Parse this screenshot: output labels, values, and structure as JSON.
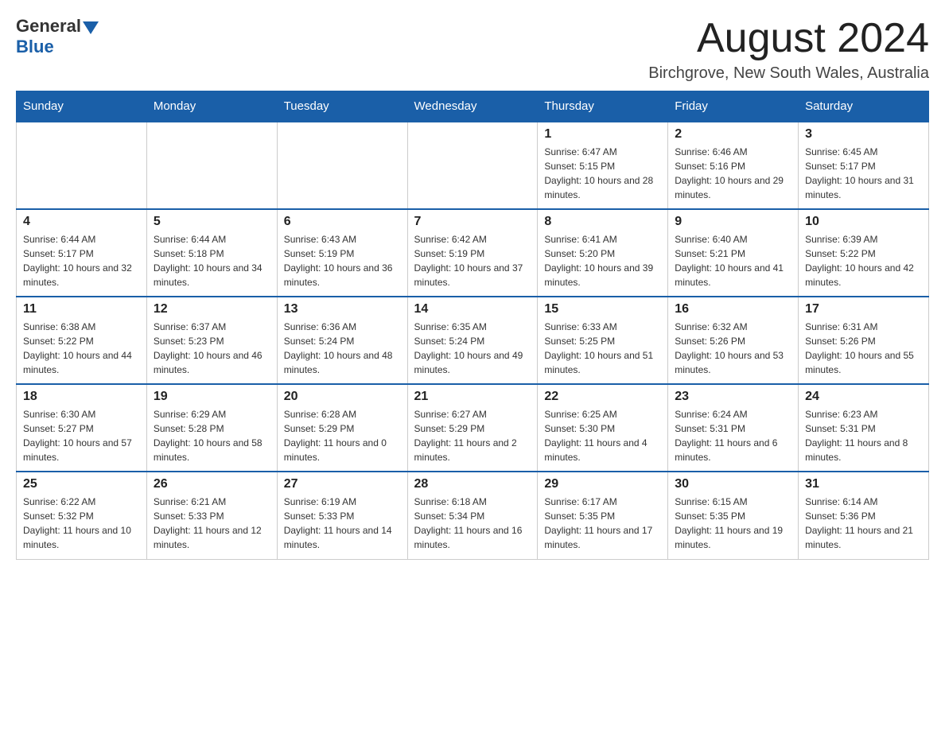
{
  "header": {
    "logo_general": "General",
    "logo_blue": "Blue",
    "month_title": "August 2024",
    "location": "Birchgrove, New South Wales, Australia"
  },
  "weekdays": [
    "Sunday",
    "Monday",
    "Tuesday",
    "Wednesday",
    "Thursday",
    "Friday",
    "Saturday"
  ],
  "weeks": [
    [
      {
        "day": "",
        "info": ""
      },
      {
        "day": "",
        "info": ""
      },
      {
        "day": "",
        "info": ""
      },
      {
        "day": "",
        "info": ""
      },
      {
        "day": "1",
        "info": "Sunrise: 6:47 AM\nSunset: 5:15 PM\nDaylight: 10 hours and 28 minutes."
      },
      {
        "day": "2",
        "info": "Sunrise: 6:46 AM\nSunset: 5:16 PM\nDaylight: 10 hours and 29 minutes."
      },
      {
        "day": "3",
        "info": "Sunrise: 6:45 AM\nSunset: 5:17 PM\nDaylight: 10 hours and 31 minutes."
      }
    ],
    [
      {
        "day": "4",
        "info": "Sunrise: 6:44 AM\nSunset: 5:17 PM\nDaylight: 10 hours and 32 minutes."
      },
      {
        "day": "5",
        "info": "Sunrise: 6:44 AM\nSunset: 5:18 PM\nDaylight: 10 hours and 34 minutes."
      },
      {
        "day": "6",
        "info": "Sunrise: 6:43 AM\nSunset: 5:19 PM\nDaylight: 10 hours and 36 minutes."
      },
      {
        "day": "7",
        "info": "Sunrise: 6:42 AM\nSunset: 5:19 PM\nDaylight: 10 hours and 37 minutes."
      },
      {
        "day": "8",
        "info": "Sunrise: 6:41 AM\nSunset: 5:20 PM\nDaylight: 10 hours and 39 minutes."
      },
      {
        "day": "9",
        "info": "Sunrise: 6:40 AM\nSunset: 5:21 PM\nDaylight: 10 hours and 41 minutes."
      },
      {
        "day": "10",
        "info": "Sunrise: 6:39 AM\nSunset: 5:22 PM\nDaylight: 10 hours and 42 minutes."
      }
    ],
    [
      {
        "day": "11",
        "info": "Sunrise: 6:38 AM\nSunset: 5:22 PM\nDaylight: 10 hours and 44 minutes."
      },
      {
        "day": "12",
        "info": "Sunrise: 6:37 AM\nSunset: 5:23 PM\nDaylight: 10 hours and 46 minutes."
      },
      {
        "day": "13",
        "info": "Sunrise: 6:36 AM\nSunset: 5:24 PM\nDaylight: 10 hours and 48 minutes."
      },
      {
        "day": "14",
        "info": "Sunrise: 6:35 AM\nSunset: 5:24 PM\nDaylight: 10 hours and 49 minutes."
      },
      {
        "day": "15",
        "info": "Sunrise: 6:33 AM\nSunset: 5:25 PM\nDaylight: 10 hours and 51 minutes."
      },
      {
        "day": "16",
        "info": "Sunrise: 6:32 AM\nSunset: 5:26 PM\nDaylight: 10 hours and 53 minutes."
      },
      {
        "day": "17",
        "info": "Sunrise: 6:31 AM\nSunset: 5:26 PM\nDaylight: 10 hours and 55 minutes."
      }
    ],
    [
      {
        "day": "18",
        "info": "Sunrise: 6:30 AM\nSunset: 5:27 PM\nDaylight: 10 hours and 57 minutes."
      },
      {
        "day": "19",
        "info": "Sunrise: 6:29 AM\nSunset: 5:28 PM\nDaylight: 10 hours and 58 minutes."
      },
      {
        "day": "20",
        "info": "Sunrise: 6:28 AM\nSunset: 5:29 PM\nDaylight: 11 hours and 0 minutes."
      },
      {
        "day": "21",
        "info": "Sunrise: 6:27 AM\nSunset: 5:29 PM\nDaylight: 11 hours and 2 minutes."
      },
      {
        "day": "22",
        "info": "Sunrise: 6:25 AM\nSunset: 5:30 PM\nDaylight: 11 hours and 4 minutes."
      },
      {
        "day": "23",
        "info": "Sunrise: 6:24 AM\nSunset: 5:31 PM\nDaylight: 11 hours and 6 minutes."
      },
      {
        "day": "24",
        "info": "Sunrise: 6:23 AM\nSunset: 5:31 PM\nDaylight: 11 hours and 8 minutes."
      }
    ],
    [
      {
        "day": "25",
        "info": "Sunrise: 6:22 AM\nSunset: 5:32 PM\nDaylight: 11 hours and 10 minutes."
      },
      {
        "day": "26",
        "info": "Sunrise: 6:21 AM\nSunset: 5:33 PM\nDaylight: 11 hours and 12 minutes."
      },
      {
        "day": "27",
        "info": "Sunrise: 6:19 AM\nSunset: 5:33 PM\nDaylight: 11 hours and 14 minutes."
      },
      {
        "day": "28",
        "info": "Sunrise: 6:18 AM\nSunset: 5:34 PM\nDaylight: 11 hours and 16 minutes."
      },
      {
        "day": "29",
        "info": "Sunrise: 6:17 AM\nSunset: 5:35 PM\nDaylight: 11 hours and 17 minutes."
      },
      {
        "day": "30",
        "info": "Sunrise: 6:15 AM\nSunset: 5:35 PM\nDaylight: 11 hours and 19 minutes."
      },
      {
        "day": "31",
        "info": "Sunrise: 6:14 AM\nSunset: 5:36 PM\nDaylight: 11 hours and 21 minutes."
      }
    ]
  ]
}
